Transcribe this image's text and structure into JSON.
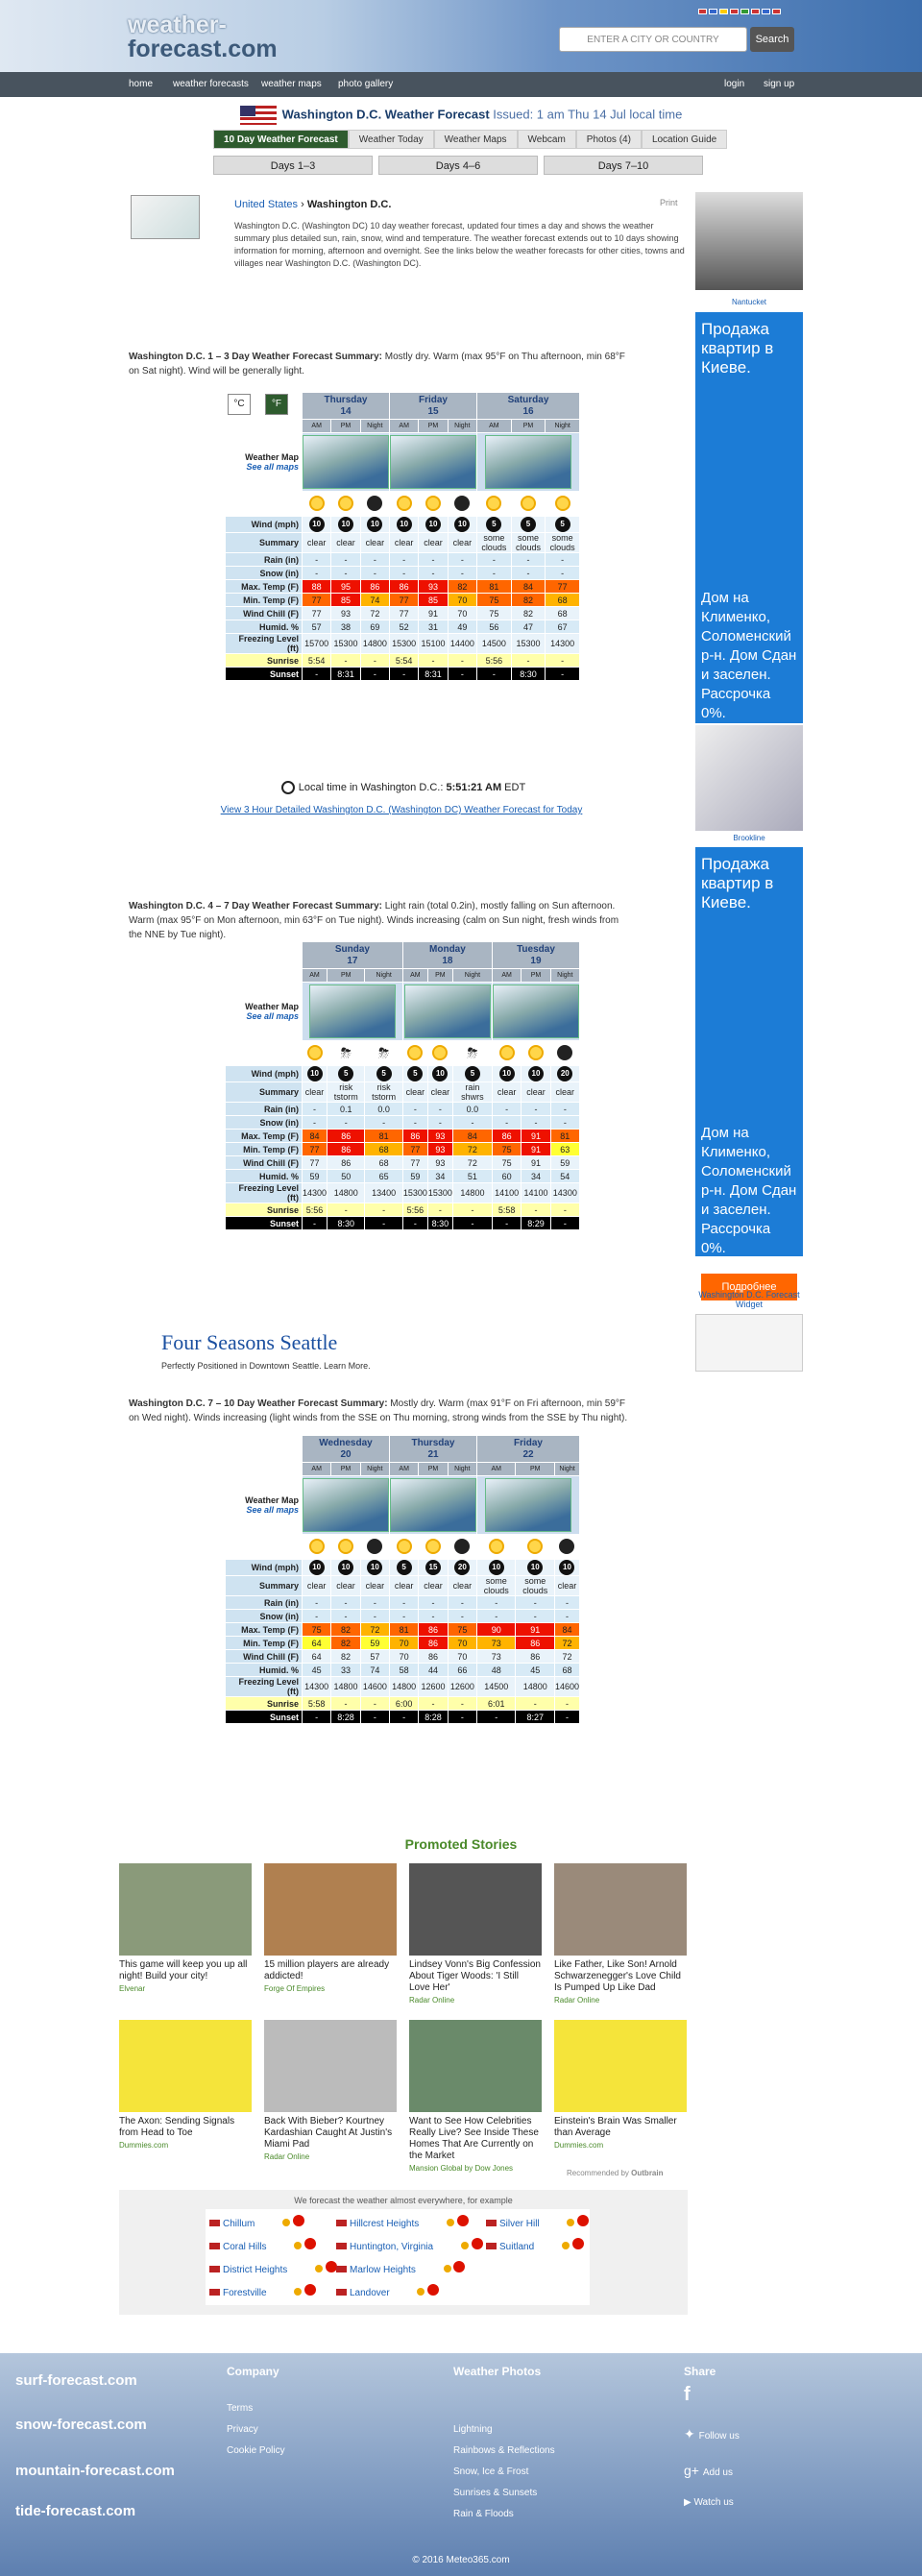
{
  "header": {
    "logo_line1": "weather-",
    "logo_line2": "forecast.com",
    "search_placeholder": "ENTER A CITY OR COUNTRY",
    "search_button": "Search"
  },
  "nav": {
    "home": "home",
    "weather_forecasts": "weather forecasts",
    "weather_maps": "weather maps",
    "photo_gallery": "photo gallery",
    "login": "login",
    "signup": "sign up"
  },
  "title": {
    "city": "Washington D.C. Weather Forecast",
    "issued": "Issued: 1 am Thu 14 Jul local time"
  },
  "tabs": [
    "10 Day Weather Forecast",
    "Weather Today",
    "Weather Maps",
    "Webcam",
    "Photos (4)",
    "Location Guide"
  ],
  "day_tabs": [
    "Days 1–3",
    "Days 4–6",
    "Days 7–10"
  ],
  "intro": {
    "country": "United States",
    "sep": " › ",
    "city": "Washington D.C.",
    "print": "Print",
    "text": "Washington D.C. (Washington DC) 10 day weather forecast, updated four times a day and shows the weather summary plus detailed sun, rain, snow, wind and temperature. The weather forecast extends out to 10 days showing information for morning, afternoon and overnight. See the links below the weather forecasts for other cities, towns and villages near Washington D.C. (Washington DC)."
  },
  "summaries": [
    {
      "head": "Washington D.C. 1 – 3 Day Weather Forecast Summary:",
      "text": " Mostly dry. Warm (max 95°F on Thu afternoon, min 68°F on Sat night). Wind will be generally light."
    },
    {
      "head": "Washington D.C. 4 – 7 Day Weather Forecast Summary:",
      "text": " Light rain (total 0.2in), mostly falling on Sun afternoon. Warm (max 95°F on Mon afternoon, min 63°F on Tue night). Winds increasing (calm on Sun night, fresh winds from the NNE by Tue night)."
    },
    {
      "head": "Washington D.C. 7 – 10 Day Weather Forecast Summary:",
      "text": " Mostly dry. Warm (max 91°F on Fri afternoon, min 59°F on Wed night). Winds increasing (light winds from the SSE on Thu morning, strong winds from the SSE by Thu night)."
    }
  ],
  "units": {
    "c": "°C",
    "f": "°F"
  },
  "labels": {
    "map": "Weather Map",
    "see_all": "See all maps",
    "wind": "Wind (mph)",
    "summary": "Summary",
    "rain": "Rain (in)",
    "snow": "Snow (in)",
    "max": "Max. Temp (F)",
    "min": "Min. Temp (F)",
    "chill": "Wind Chill (F)",
    "humid": "Humid. %",
    "freeze": "Freezing Level (ft)",
    "sunrise": "Sunrise",
    "sunset": "Sunset",
    "am": "AM",
    "pm": "PM",
    "night": "Night"
  },
  "tables": [
    {
      "days": [
        {
          "name": "Thursday",
          "num": "14"
        },
        {
          "name": "Friday",
          "num": "15"
        },
        {
          "name": "Saturday",
          "num": "16"
        }
      ],
      "wind": [
        "10",
        "10",
        "10",
        "10",
        "10",
        "10",
        "5",
        "5",
        "5"
      ],
      "summary": [
        "clear",
        "clear",
        "clear",
        "clear",
        "clear",
        "clear",
        "some clouds",
        "some clouds",
        "some clouds"
      ],
      "rain": [
        "-",
        "-",
        "-",
        "-",
        "-",
        "-",
        "-",
        "-",
        "-"
      ],
      "snow": [
        "-",
        "-",
        "-",
        "-",
        "-",
        "-",
        "-",
        "-",
        "-"
      ],
      "max": [
        "88",
        "95",
        "86",
        "86",
        "93",
        "82",
        "81",
        "84",
        "77"
      ],
      "min": [
        "77",
        "85",
        "74",
        "77",
        "85",
        "70",
        "75",
        "82",
        "68"
      ],
      "chill": [
        "77",
        "93",
        "72",
        "77",
        "91",
        "70",
        "75",
        "82",
        "68"
      ],
      "humid": [
        "57",
        "38",
        "69",
        "52",
        "31",
        "49",
        "56",
        "47",
        "67"
      ],
      "freeze": [
        "15700",
        "15300",
        "14800",
        "15300",
        "15100",
        "14400",
        "14500",
        "15300",
        "14300"
      ],
      "sunrise": [
        "5:54",
        "-",
        "-",
        "5:54",
        "-",
        "-",
        "5:56",
        "-",
        "-"
      ],
      "sunset": [
        "-",
        "8:31",
        "-",
        "-",
        "8:31",
        "-",
        "-",
        "8:30",
        "-"
      ]
    },
    {
      "days": [
        {
          "name": "Sunday",
          "num": "17"
        },
        {
          "name": "Monday",
          "num": "18"
        },
        {
          "name": "Tuesday",
          "num": "19"
        }
      ],
      "wind": [
        "10",
        "5",
        "5",
        "5",
        "10",
        "5",
        "10",
        "10",
        "20"
      ],
      "summary": [
        "clear",
        "risk tstorm",
        "risk tstorm",
        "clear",
        "clear",
        "rain shwrs",
        "clear",
        "clear",
        "clear"
      ],
      "rain": [
        "-",
        "0.1",
        "0.0",
        "-",
        "-",
        "0.0",
        "-",
        "-",
        "-"
      ],
      "snow": [
        "-",
        "-",
        "-",
        "-",
        "-",
        "-",
        "-",
        "-",
        "-"
      ],
      "max": [
        "84",
        "86",
        "81",
        "86",
        "93",
        "84",
        "86",
        "91",
        "81"
      ],
      "min": [
        "77",
        "86",
        "68",
        "77",
        "93",
        "72",
        "75",
        "91",
        "63"
      ],
      "chill": [
        "77",
        "86",
        "68",
        "77",
        "93",
        "72",
        "75",
        "91",
        "59"
      ],
      "humid": [
        "59",
        "50",
        "65",
        "59",
        "34",
        "51",
        "60",
        "34",
        "54"
      ],
      "freeze": [
        "14300",
        "14800",
        "13400",
        "15300",
        "15300",
        "14800",
        "14100",
        "14100",
        "14300"
      ],
      "sunrise": [
        "5:56",
        "-",
        "-",
        "5:56",
        "-",
        "-",
        "5:58",
        "-",
        "-"
      ],
      "sunset": [
        "-",
        "8:30",
        "-",
        "-",
        "8:30",
        "-",
        "-",
        "8:29",
        "-"
      ]
    },
    {
      "days": [
        {
          "name": "Wednesday",
          "num": "20"
        },
        {
          "name": "Thursday",
          "num": "21"
        },
        {
          "name": "Friday",
          "num": "22"
        }
      ],
      "wind": [
        "10",
        "10",
        "10",
        "5",
        "15",
        "20",
        "10",
        "10",
        "10"
      ],
      "summary": [
        "clear",
        "clear",
        "clear",
        "clear",
        "clear",
        "clear",
        "some clouds",
        "some clouds",
        "clear"
      ],
      "rain": [
        "-",
        "-",
        "-",
        "-",
        "-",
        "-",
        "-",
        "-",
        "-"
      ],
      "snow": [
        "-",
        "-",
        "-",
        "-",
        "-",
        "-",
        "-",
        "-",
        "-"
      ],
      "max": [
        "75",
        "82",
        "72",
        "81",
        "86",
        "75",
        "90",
        "91",
        "84"
      ],
      "min": [
        "64",
        "82",
        "59",
        "70",
        "86",
        "70",
        "73",
        "86",
        "72"
      ],
      "chill": [
        "64",
        "82",
        "57",
        "70",
        "86",
        "70",
        "73",
        "86",
        "72"
      ],
      "humid": [
        "45",
        "33",
        "74",
        "58",
        "44",
        "66",
        "48",
        "45",
        "68"
      ],
      "freeze": [
        "14300",
        "14800",
        "14600",
        "14800",
        "12600",
        "12600",
        "14500",
        "14800",
        "14600"
      ],
      "sunrise": [
        "5:58",
        "-",
        "-",
        "6:00",
        "-",
        "-",
        "6:01",
        "-",
        "-"
      ],
      "sunset": [
        "-",
        "8:28",
        "-",
        "-",
        "8:28",
        "-",
        "-",
        "8:27",
        "-"
      ]
    }
  ],
  "localtime": {
    "label": "Local time in Washington D.C.: ",
    "time": "5:51:21 AM",
    "tz": " EDT"
  },
  "detail_link": "View 3 Hour Detailed Washington D.C. (Washington DC) Weather Forecast for Today",
  "ads": {
    "fs_title": "Four Seasons Seattle",
    "fs_sub": "Perfectly Positioned in Downtown Seattle. Learn More.",
    "ru_text": "Продажа квартир в Киеве.",
    "ru_sub": "Дом на Клименко, Соломенский р-н. Дом Сдан и заселен. Рассрочка 0%.",
    "ru_btn": "Подробнее"
  },
  "sidebar": {
    "nantucket": "Nantucket",
    "brooklyn": "Brookline",
    "widget": "Washington D.C. Forecast Widget"
  },
  "promoted": {
    "title": "Promoted Stories",
    "recommended": "Recommended by",
    "items": [
      {
        "t": "This game will keep you up all night! Build your city!",
        "s": "Elvenar"
      },
      {
        "t": "15 million players are already addicted!",
        "s": "Forge Of Empires"
      },
      {
        "t": "Lindsey Vonn's Big Confession About Tiger Woods: 'I Still Love Her'",
        "s": "Radar Online"
      },
      {
        "t": "Like Father, Like Son! Arnold Schwarzenegger's Love Child Is Pumped Up Like Dad",
        "s": "Radar Online"
      },
      {
        "t": "The Axon: Sending Signals from Head to Toe",
        "s": "Dummies.com"
      },
      {
        "t": "Back With Bieber? Kourtney Kardashian Caught At Justin's Miami Pad",
        "s": "Radar Online"
      },
      {
        "t": "Want to See How Celebrities Really Live? See Inside These Homes That Are Currently on the Market",
        "s": "Mansion Global by Dow Jones"
      },
      {
        "t": "Einstein's Brain Was Smaller than Average",
        "s": "Dummies.com"
      }
    ]
  },
  "nearby": {
    "head": "We forecast the weather almost everywhere, for example",
    "items": [
      "Chillum",
      "Hillcrest Heights",
      "Silver Hill",
      "Coral Hills",
      "Huntington, Virginia",
      "Suitland",
      "District Heights",
      "Marlow Heights",
      "Forestville",
      "Landover"
    ]
  },
  "footer": {
    "company": "Company",
    "photos": "Weather Photos",
    "share": "Share",
    "links": [
      "Terms",
      "Privacy",
      "Cookie Policy"
    ],
    "photo_links": [
      "Lightning",
      "Rainbows & Reflections",
      "Snow, Ice & Frost",
      "Sunrises & Sunsets",
      "Rain & Floods"
    ],
    "follow": "Follow us",
    "add": "Add us",
    "watch": "Watch us",
    "copyright": "© 2016 Meteo365.com",
    "brands": [
      "surf-forecast.com",
      "snow-forecast.com",
      "mountain-forecast.com",
      "tide-forecast.com"
    ]
  }
}
